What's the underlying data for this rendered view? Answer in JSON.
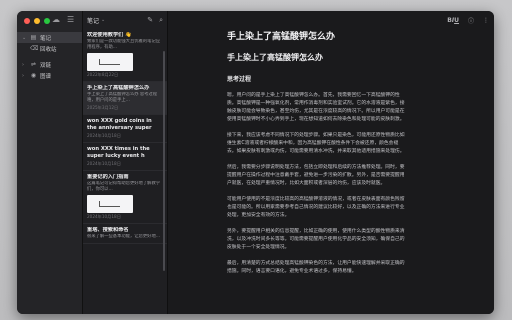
{
  "sidebar": {
    "items": [
      {
        "label": "笔记",
        "icon": "note-icon",
        "chevron": "⌄",
        "active": true
      },
      {
        "label": "回收站",
        "icon": "trash-icon",
        "chevron": "",
        "active": false
      }
    ],
    "items2": [
      {
        "label": "双链",
        "icon": "link-icon",
        "chevron": "›"
      },
      {
        "label": "图谱",
        "icon": "graph-icon",
        "chevron": "›"
      }
    ]
  },
  "notelist": {
    "title": "笔记",
    "notes": [
      {
        "title": "欢迎使用教学们 👋",
        "snippet": "致家们是一款功能强大且优雅的笔记应用程序，有助…",
        "date": "2022年8月22日",
        "thumb": true
      },
      {
        "title": "手上染上了高锰酸钾怎么办",
        "snippet": "手上染上了高锰酸钾怎么办 思考过程 嘻，用户问的是手上…",
        "date": "2025年3月12日",
        "thumb": false
      },
      {
        "title": "won XXX gold coins in the anniversary super",
        "snippet": "",
        "date": "2024年10月18日",
        "thumb": false
      },
      {
        "title": "won XXX times in the super lucky event h",
        "snippet": "",
        "date": "2024年10月18日",
        "thumb": false
      },
      {
        "title": "重要记的入门指南",
        "snippet": "这篇笔记可记得帮助您更好地了解教学们，你可以…",
        "date": "2024年10月18日",
        "thumb": true
      },
      {
        "title": "重塔、搜索和命名",
        "snippet": "很来了解一些基本功能，让您更好地…",
        "date": "",
        "thumb": false
      }
    ]
  },
  "editor": {
    "h1": "手上染上了高锰酸钾怎么办",
    "h2": "手上染上了高锰酸钾怎么办",
    "h3": "思考过程",
    "paragraphs": [
      "嗯，用户问的是手上染上了高锰酸钾怎么办。首先，我需要回忆一下高锰酸钾的性质。高锰酸钾是一种强氧化剂，常用作消毒剂和实验室试剂。它的水溶液是紫色，接触皮肤可能会导致染色，甚至灼伤，尤其是在浓度较高的情况下。所以用户可能是在使用高锰酸钾时不小心弄到手上，现在想知道如何去除染色和处理可能的皮肤刺激。",
      "接下来，我应该考虑不同情况下的处理步骤。如果只是染色，可能用还原性物质比如维生素C溶液或者柠檬酸来中和，因为高锰酸钾在酸性条件下会被还原，颜色会褪去。如果皮肤有刺激或灼伤，可能需要用清水冲洗，并采取其他适用措施来处理伤。",
      "然后，我需要分步骤说明处理方法，包括立即处理和后续的方法推荐处理。同时，要提醒用户在操作过程中注意戴手套，避免进一步污染的扩散。另外，是否需要提醒用户就医，在处理严重情况时，比如大面积或者深层的灼伤，应该及时就医。",
      "可能用户使用的不是浓度比较高的高锰酸钾溶液的情况，或者在皮肤表面有颜色残留也是可能的。所以用家需要参考自己情况的建议比较好，以及正确的方法来进行专业处理，更加安全有效的方法。",
      "另外，要提醒用户相关的信息提醒，比如正确的使用，使用什么类型的酸性物质来清洗，以及冲洗时间多长等等。可能需要提醒用户使用化学品的安全须知，确保自己的皮肤处于一个安全处理情况。",
      "最后，用清楚的方式总结处理高锰酸钾染色的方法，让用户能快速理解并采取正确的措施。同时，语言要口语化，避免专业术语过多，保持易懂。"
    ]
  }
}
